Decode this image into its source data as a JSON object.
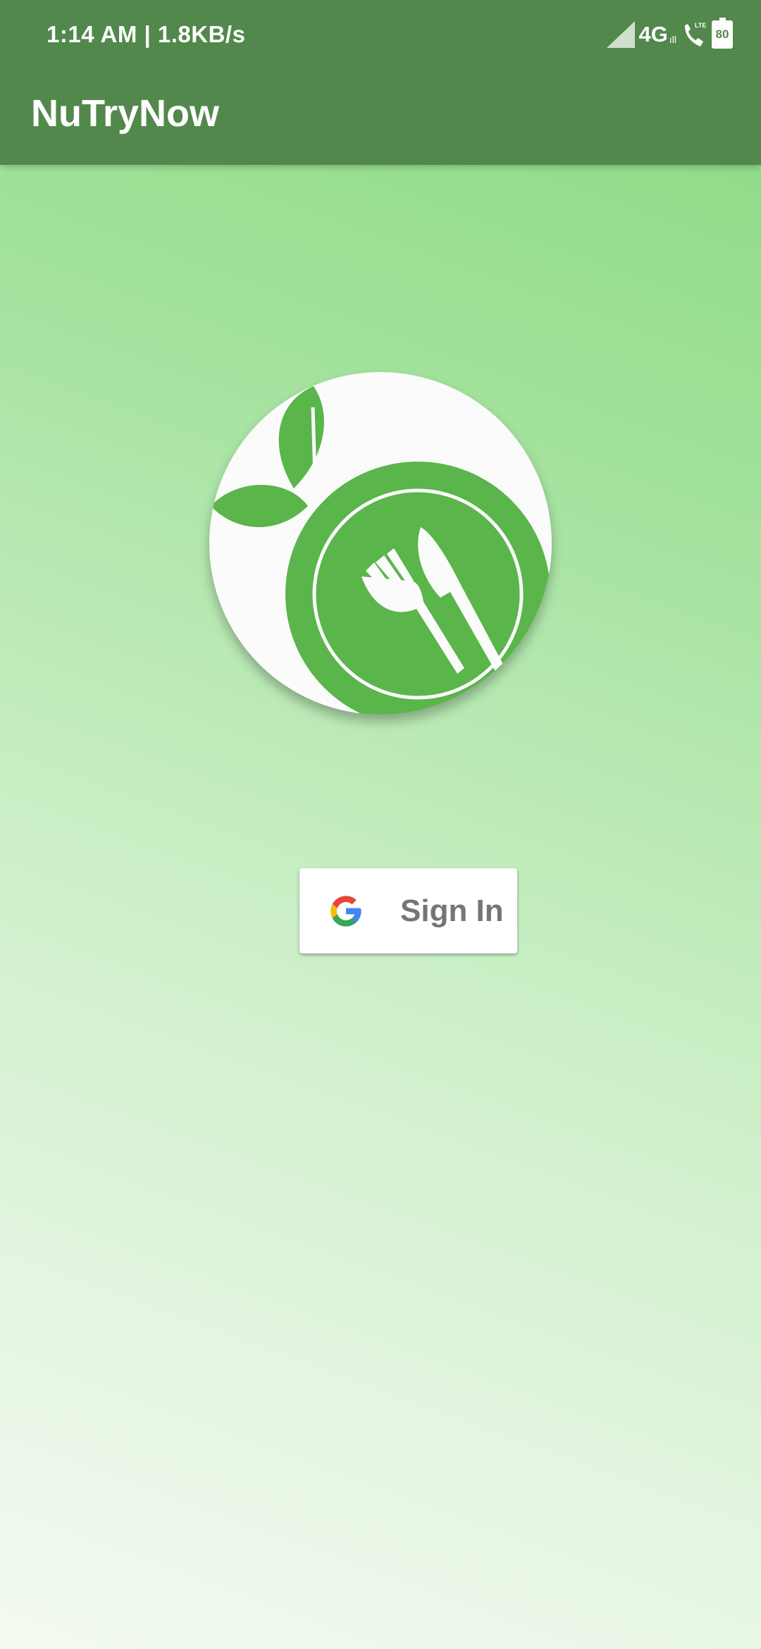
{
  "status_bar": {
    "time_speed": "1:14 AM | 1.8KB/s",
    "network": "4G",
    "network_sub": "ıll",
    "battery": "80"
  },
  "app_bar": {
    "title": "NuTryNow"
  },
  "logo": {
    "icon": "plate-fork-knife-leaves-logo"
  },
  "signin": {
    "label": "Sign In",
    "icon": "google-icon"
  },
  "colors": {
    "app_bar": "#52884c",
    "logo_green": "#5ab54a",
    "background_top": "#88d97e",
    "background_bottom": "#f3faf1"
  }
}
